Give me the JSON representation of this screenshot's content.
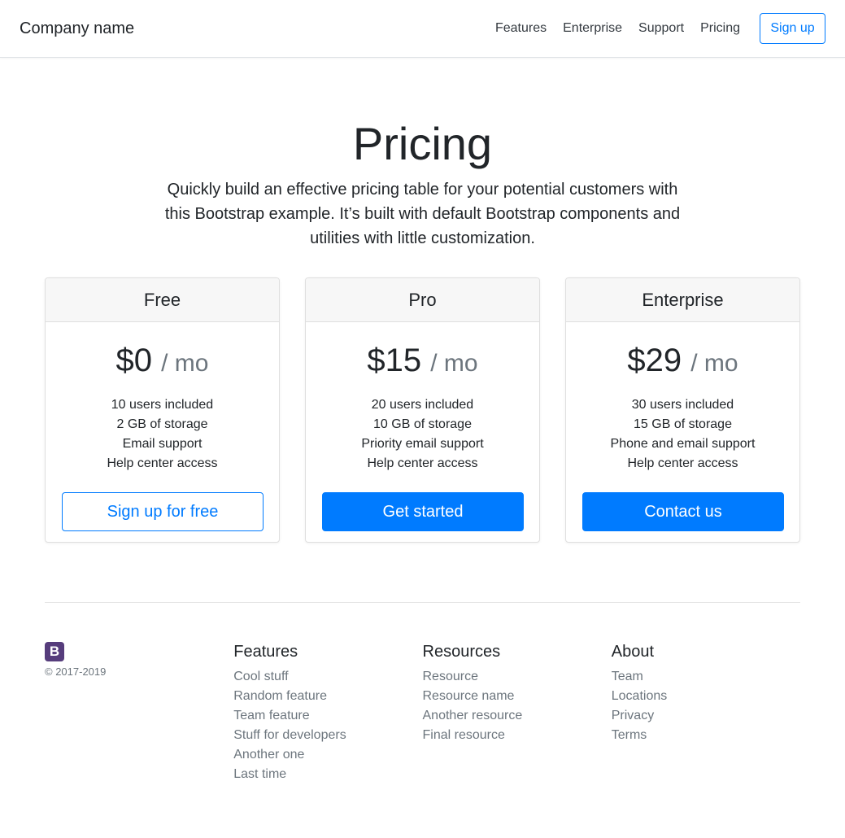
{
  "navbar": {
    "brand": "Company name",
    "links": [
      "Features",
      "Enterprise",
      "Support",
      "Pricing"
    ],
    "signup_label": "Sign up"
  },
  "hero": {
    "title": "Pricing",
    "lead": "Quickly build an effective pricing table for your potential customers with this Bootstrap example. It’s built with default Bootstrap components and utilities with little customization."
  },
  "plans": [
    {
      "name": "Free",
      "price": "$0",
      "period": "/ mo",
      "features": [
        "10 users included",
        "2 GB of storage",
        "Email support",
        "Help center access"
      ],
      "button_label": "Sign up for free",
      "button_style": "outline"
    },
    {
      "name": "Pro",
      "price": "$15",
      "period": "/ mo",
      "features": [
        "20 users included",
        "10 GB of storage",
        "Priority email support",
        "Help center access"
      ],
      "button_label": "Get started",
      "button_style": "primary"
    },
    {
      "name": "Enterprise",
      "price": "$29",
      "period": "/ mo",
      "features": [
        "30 users included",
        "15 GB of storage",
        "Phone and email support",
        "Help center access"
      ],
      "button_label": "Contact us",
      "button_style": "primary"
    }
  ],
  "footer": {
    "logo_letter": "B",
    "logo_color": "#563d7c",
    "copyright": "© 2017-2019",
    "columns": [
      {
        "title": "Features",
        "links": [
          "Cool stuff",
          "Random feature",
          "Team feature",
          "Stuff for developers",
          "Another one",
          "Last time"
        ]
      },
      {
        "title": "Resources",
        "links": [
          "Resource",
          "Resource name",
          "Another resource",
          "Final resource"
        ]
      },
      {
        "title": "About",
        "links": [
          "Team",
          "Locations",
          "Privacy",
          "Terms"
        ]
      }
    ]
  },
  "colors": {
    "primary": "#007bff",
    "muted": "#6c757d",
    "text": "#212529",
    "card_header_bg": "#f7f7f7"
  }
}
